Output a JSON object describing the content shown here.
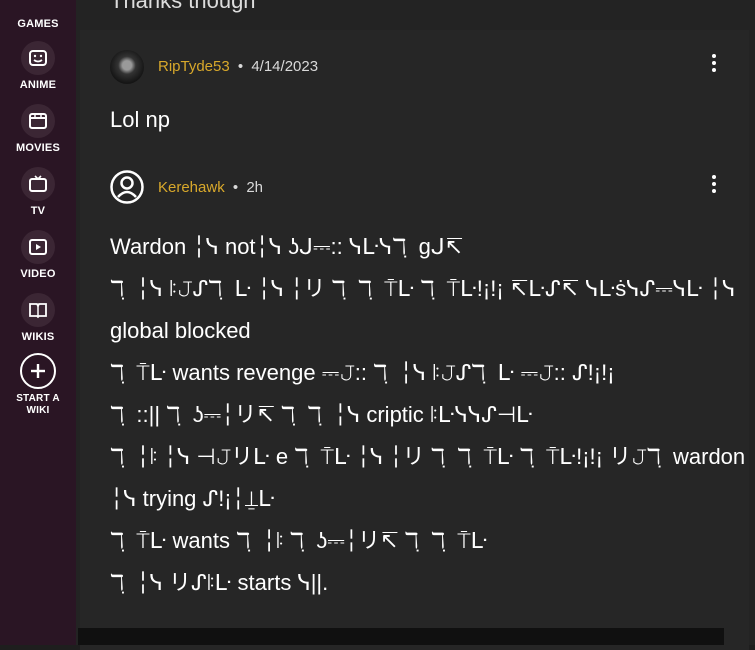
{
  "sidebar": {
    "items": [
      {
        "label": "GAMES",
        "icon": "gamepad-icon"
      },
      {
        "label": "ANIME",
        "icon": "anime-face-icon"
      },
      {
        "label": "MOVIES",
        "icon": "clapperboard-icon"
      },
      {
        "label": "TV",
        "icon": "tv-icon"
      },
      {
        "label": "VIDEO",
        "icon": "play-icon"
      },
      {
        "label": "WIKIS",
        "icon": "book-icon"
      }
    ],
    "start_wiki": {
      "line1": "START A",
      "line2": "WIKI",
      "icon": "plus-icon"
    }
  },
  "top_partial_text": "Thanks though",
  "comments": [
    {
      "username": "RipTyde53",
      "separator": "•",
      "date": "4/14/2023",
      "text": "Lol np"
    },
    {
      "username": "Kerehawk",
      "separator": "•",
      "date": "2h",
      "lines": [
        "Wardon ╎ᓭ not╎ᓭ ʖᒍ⎓:: ᓭᒷᓭℸ ̣ gᒍ↸",
        "ℸ ̣ ╎ᓭ ꖎ𝙹ᔑℸ ̣ ᒷ ╎ᓭ ╎リ ℸ ̣ ℸ ̣ ⍑ᒷ ℸ ̣ ⍑ᒷ!¡!¡ ↸ᒷᔑ↸ ᓭᒷṡᓭᔑ⎓ᓭᒷ ╎ᓭ",
        "global blocked",
        "ℸ ̣ ⍑ᒷ wants revenge ⎓𝙹:: ℸ ̣ ╎ᓭ ꖎ𝙹ᔑℸ ̣ ᒷ ⎓𝙹:: ᔑ!¡!¡",
        "ℸ ̣ ::|| ℸ ̣ ʖ⎓╎リ↸ ℸ ̣ ℸ ̣ ╎ᓭ criptic ꖎᒷᓭᓭᔑ⊣ᒷ",
        "ℸ ̣ ╎ꖎ ╎ᓭ ⊣𝙹リᒷ e ℸ ̣ ⍑ᒷ ╎ᓭ ╎リ ℸ ̣ ℸ ̣ ⍑ᒷ ℸ ̣ ⍑ᒷ!¡!¡ リ𝙹ℸ ̣ wardon",
        "╎ᓭ trying ᔑ!¡╎⍊ᒷ",
        "ℸ ̣ ⍑ᒷ wants ℸ ̣ ╎ꖎ ℸ ̣ ʖ⎓╎リ↸ ℸ ̣ ℸ ̣ ⍑ᒷ",
        "ℸ ̣ ╎ᓭ リᔑꖎᒷ starts ᓭ||."
      ]
    }
  ]
}
